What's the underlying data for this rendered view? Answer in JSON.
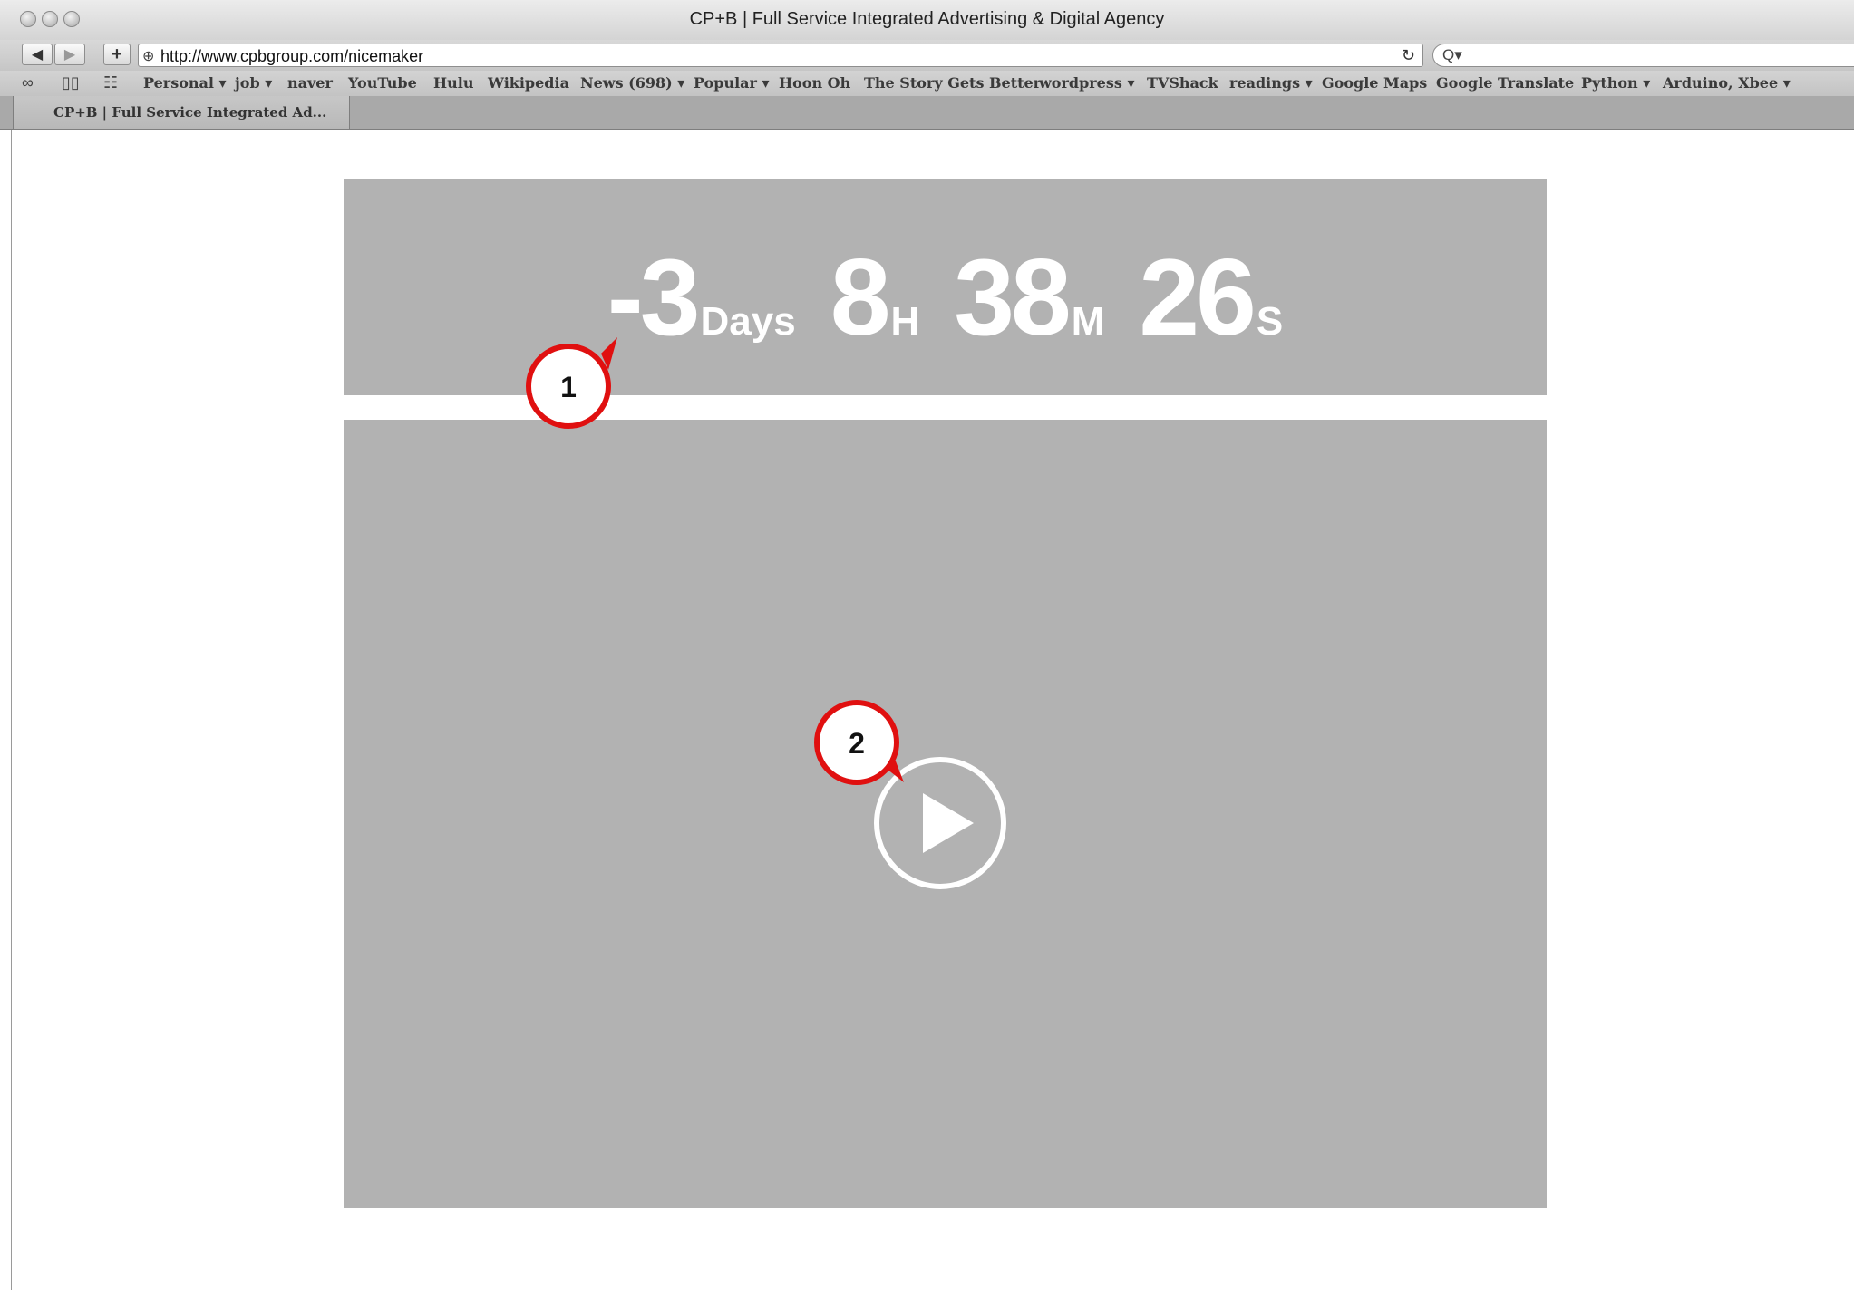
{
  "window": {
    "title": "CP+B | Full Service Integrated Advertising & Digital Agency"
  },
  "toolbar": {
    "back_icon": "back-arrow-icon",
    "forward_icon": "forward-arrow-icon",
    "add_icon": "plus-icon",
    "url": "http://www.cpbgroup.com/nicemaker",
    "reload_icon": "reload-icon",
    "search_placeholder": ""
  },
  "bookmarks": [
    {
      "label": "Personal",
      "menu": true
    },
    {
      "label": "job",
      "menu": true
    },
    {
      "label": "naver",
      "menu": false
    },
    {
      "label": "YouTube",
      "menu": false
    },
    {
      "label": "Hulu",
      "menu": false
    },
    {
      "label": "Wikipedia",
      "menu": false
    },
    {
      "label": "News (698)",
      "menu": true
    },
    {
      "label": "Popular",
      "menu": true
    },
    {
      "label": "Hoon Oh",
      "menu": false
    },
    {
      "label": "The Story Gets Better",
      "menu": false
    },
    {
      "label": "wordpress",
      "menu": true
    },
    {
      "label": "TVShack",
      "menu": false
    },
    {
      "label": "readings",
      "menu": true
    },
    {
      "label": "Google Maps",
      "menu": false
    },
    {
      "label": "Google Translate",
      "menu": false
    },
    {
      "label": "Python",
      "menu": true
    },
    {
      "label": "Arduino, Xbee",
      "menu": true
    }
  ],
  "tab": {
    "label": "CP+B | Full Service Integrated Ad..."
  },
  "countdown": {
    "days": "-3",
    "days_unit": "Days",
    "hours": "8",
    "hours_unit": "H",
    "minutes": "38",
    "minutes_unit": "M",
    "seconds": "26",
    "seconds_unit": "S"
  },
  "callouts": [
    {
      "number": "1"
    },
    {
      "number": "2"
    }
  ],
  "colors": {
    "panel": "#b2b2b2",
    "callout_border": "#e01010",
    "text": "#ffffff"
  }
}
